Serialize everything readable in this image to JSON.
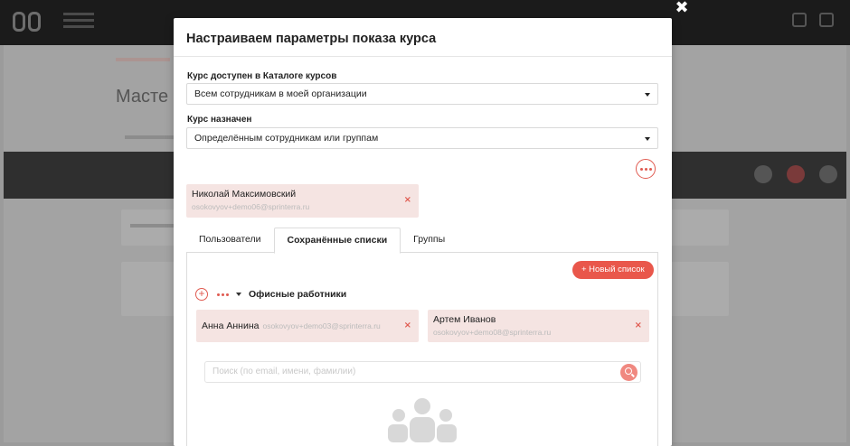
{
  "modal": {
    "title": "Настраиваем параметры показа курса",
    "close_glyph": "✖",
    "catalog_label": "Курс доступен в Каталоге курсов",
    "catalog_value": "Всем сотрудникам в моей организации",
    "assigned_label": "Курс назначен",
    "assigned_value": "Определённым сотрудникам или группам",
    "assigned_user": {
      "name": "Николай Максимовский",
      "email": "osokovyov+demo06@sprinterra.ru",
      "remove_glyph": "×"
    },
    "tabs": [
      {
        "label": "Пользователи",
        "active": false
      },
      {
        "label": "Сохранённые списки",
        "active": true
      },
      {
        "label": "Группы",
        "active": false
      }
    ],
    "new_list_button": "+ Новый список",
    "saved_list": {
      "name": "Офисные работники",
      "members": [
        {
          "name": "Анна Аннина",
          "email": "osokovyov+demo03@sprinterra.ru",
          "remove_glyph": "×"
        },
        {
          "name": "Артем Иванов",
          "email": "osokovyov+demo08@sprinterra.ru",
          "remove_glyph": "×"
        }
      ]
    },
    "search_placeholder": "Поиск (по email, имени, фамилии)"
  },
  "background": {
    "page_title": "Масте"
  },
  "colors": {
    "accent": "#e9574b",
    "chip_bg": "#f5e4e2",
    "overlay": "#9b9b9b"
  },
  "icons": [
    "close-icon",
    "more-dots-icon",
    "remove-icon",
    "plus-circle-icon",
    "caret-down-icon",
    "search-icon",
    "people-group-icon"
  ]
}
